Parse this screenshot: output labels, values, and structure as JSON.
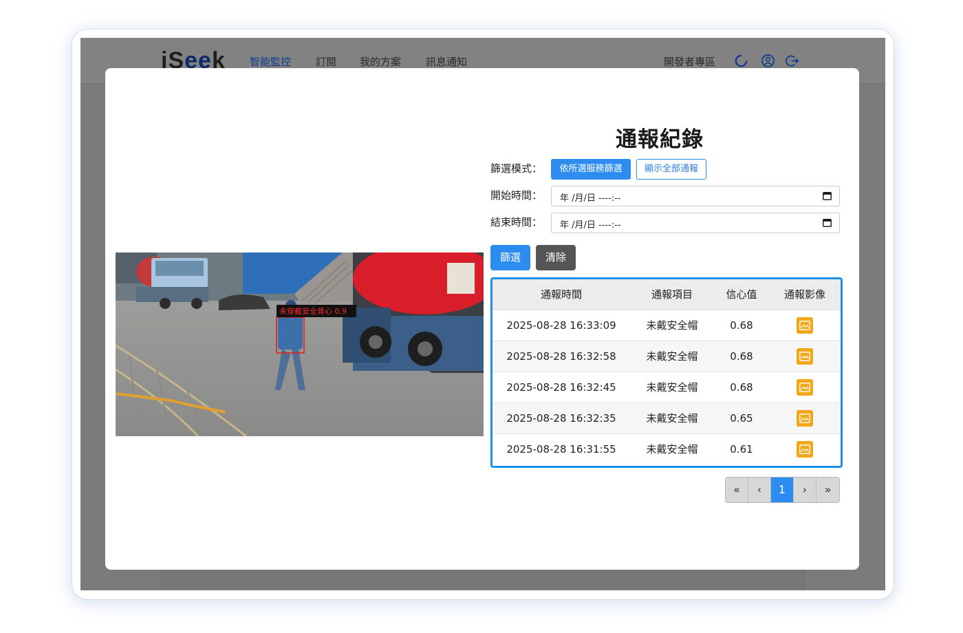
{
  "app": {
    "logo": "iS",
    "logo_mid": "ee",
    "logo_end": "k"
  },
  "nav": {
    "items": [
      "智能監控",
      "訂閱",
      "我的方案",
      "訊息通知"
    ],
    "active": "智能監控"
  },
  "topbar": {
    "developer": "開發者專區",
    "icons": [
      "loading-ring-icon",
      "user-circle-icon",
      "logout-icon"
    ]
  },
  "modal": {
    "title": "通報紀錄",
    "filter_mode_label": "篩選模式：",
    "filter_mode_options": [
      "依所選服務篩選",
      "顯示全部通報"
    ],
    "start_label": "開始時間：",
    "end_label": "結束時間：",
    "start_value": "年 /月/日 ----:--",
    "end_value": "年 /月/日 ----:--",
    "filter_button": "篩選",
    "clear_button": "清除"
  },
  "snapshot": {
    "detection_label": "未穿戴安全背心 0.9"
  },
  "table": {
    "headers": [
      "通報時間",
      "通報項目",
      "信心值",
      "通報影像"
    ],
    "rows": [
      {
        "time": "2025-08-28 16:33:09",
        "item": "未戴安全帽",
        "confidence": "0.68"
      },
      {
        "time": "2025-08-28 16:32:58",
        "item": "未戴安全帽",
        "confidence": "0.68"
      },
      {
        "time": "2025-08-28 16:32:45",
        "item": "未戴安全帽",
        "confidence": "0.68"
      },
      {
        "time": "2025-08-28 16:32:35",
        "item": "未戴安全帽",
        "confidence": "0.65"
      },
      {
        "time": "2025-08-28 16:31:55",
        "item": "未戴安全帽",
        "confidence": "0.61"
      }
    ]
  },
  "pagination": {
    "first": "«",
    "prev": "‹",
    "current": "1",
    "next": "›",
    "last": "»"
  },
  "colors": {
    "accent": "#2d8cf0",
    "table_border": "#1e90e8",
    "image_button": "#f0a818",
    "overlay": "#7b7b7b"
  }
}
